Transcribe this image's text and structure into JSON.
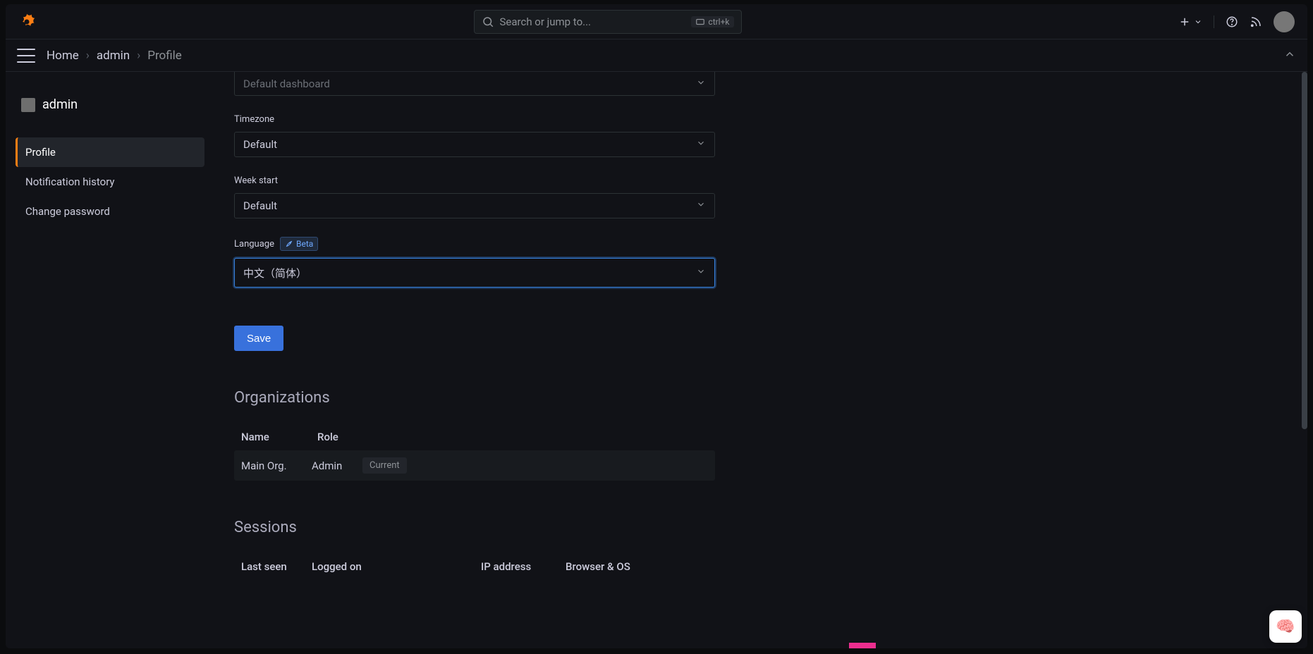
{
  "header": {
    "search_placeholder": "Search or jump to...",
    "kbd_hint": "ctrl+k"
  },
  "breadcrumb": {
    "home": "Home",
    "admin": "admin",
    "current": "Profile"
  },
  "sidebar": {
    "user": "admin",
    "items": [
      {
        "label": "Profile",
        "active": true
      },
      {
        "label": "Notification history",
        "active": false
      },
      {
        "label": "Change password",
        "active": false
      }
    ]
  },
  "form": {
    "dashboard_placeholder": "Default dashboard",
    "timezone_label": "Timezone",
    "timezone_value": "Default",
    "weekstart_label": "Week start",
    "weekstart_value": "Default",
    "language_label": "Language",
    "language_value": "中文（简体）",
    "beta_badge": "Beta",
    "save_label": "Save"
  },
  "organizations": {
    "title": "Organizations",
    "col_name": "Name",
    "col_role": "Role",
    "rows": [
      {
        "name": "Main Org.",
        "role": "Admin",
        "badge": "Current"
      }
    ]
  },
  "sessions": {
    "title": "Sessions",
    "col_lastseen": "Last seen",
    "col_loggedon": "Logged on",
    "col_ip": "IP address",
    "col_browser": "Browser & OS"
  }
}
